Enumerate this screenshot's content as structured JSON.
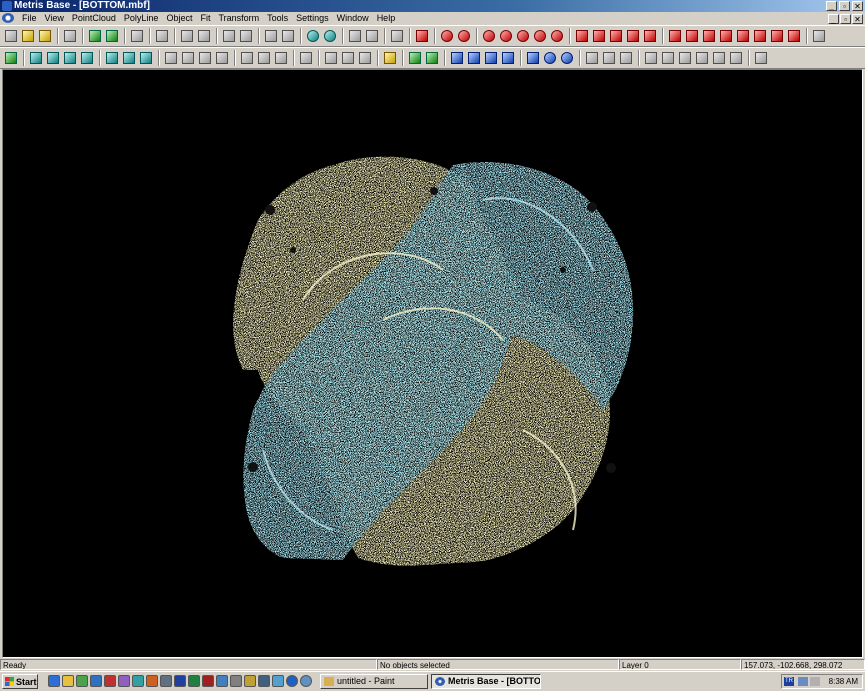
{
  "window": {
    "title": "Metris Base - [BOTTOM.mbf]",
    "controls": [
      "_",
      "▫",
      "✕"
    ]
  },
  "menu": {
    "items": [
      "File",
      "View",
      "PointCloud",
      "PolyLine",
      "Object",
      "Fit",
      "Transform",
      "Tools",
      "Settings",
      "Window",
      "Help"
    ],
    "doc_controls": [
      "_",
      "▫",
      "✕"
    ]
  },
  "toolbar1": {
    "icons": [
      "new-icon",
      "open-icon",
      "save-icon",
      "sep",
      "print-icon",
      "sep",
      "import-icon",
      "export-icon",
      "sep",
      "undo-icon",
      "sep",
      "layers-icon",
      "sep",
      "pen-icon",
      "pen2-icon",
      "sep",
      "filter-icon",
      "filter2-icon",
      "sep",
      "lock-icon",
      "lock2-icon",
      "sep",
      "sphere-icon",
      "sphere2-icon",
      "sep",
      "hatch-icon",
      "hatch2-icon",
      "sep",
      "info-icon",
      "sep",
      "binoculars-icon",
      "sep",
      "zoom-in-icon",
      "zoom-out-icon",
      "sep",
      "zoom-window-icon",
      "zoom-all-icon",
      "zoom-plus-icon",
      "zoom-minus-icon",
      "zoom-prev-icon",
      "sep",
      "cube-icon",
      "cube-top-icon",
      "cube-front-icon",
      "cube-red-icon",
      "cube-side-icon",
      "sep",
      "view-1-icon",
      "view-2-icon",
      "view-3-icon",
      "view-4-icon",
      "view-5-icon",
      "view-6-icon",
      "view-7-icon",
      "view-8-icon",
      "sep",
      "window-icon"
    ]
  },
  "toolbar2": {
    "icons": [
      "pointcloud-icon",
      "sep",
      "grid-icon",
      "grid2-icon",
      "grid3-icon",
      "grid4-icon",
      "sep",
      "mesh-icon",
      "mesh2-icon",
      "mesh3-icon",
      "sep",
      "shape-icon",
      "shape2-icon",
      "shape3-icon",
      "shape4-icon",
      "sep",
      "square-icon",
      "square2-icon",
      "square3-icon",
      "sep",
      "plane-icon",
      "sep",
      "measure-icon",
      "measure2-icon",
      "measure3-icon",
      "sep",
      "note-icon",
      "sep",
      "check-icon",
      "check2-icon",
      "sep",
      "cylinder-icon",
      "cylinder2-icon",
      "cylinder3-icon",
      "cylinder4-icon",
      "sep",
      "select-icon",
      "rotate-icon",
      "orbit-icon",
      "sep",
      "align-icon",
      "align2-icon",
      "align3-icon",
      "sep",
      "transform-icon",
      "transform2-icon",
      "transform3-icon",
      "transform4-icon",
      "transform5-icon",
      "transform6-icon",
      "sep",
      "axis-icon"
    ]
  },
  "status": {
    "ready": "Ready",
    "selection": "No objects selected",
    "layer": "Layer 0",
    "coordinates": "157.073, -102.668, 298.072"
  },
  "taskbar": {
    "start_label": "Start",
    "tasks": [
      {
        "label": "untitled - Paint",
        "active": false
      },
      {
        "label": "Metris Base - [BOTTO...",
        "active": true
      }
    ],
    "tray_lang": "TR",
    "clock": "8:38 AM"
  },
  "colors": {
    "cloud_yellow": "#f0ecb8",
    "cloud_cyan": "#a8e6f4",
    "viewport_bg": "#000000"
  }
}
